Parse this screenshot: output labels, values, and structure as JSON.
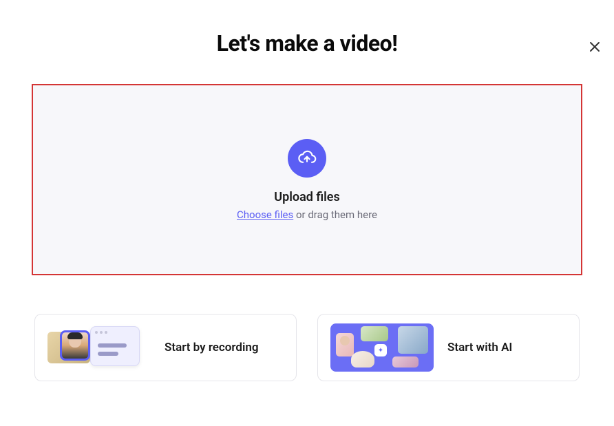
{
  "title": "Let's make a video!",
  "close_icon": "close",
  "upload": {
    "heading": "Upload files",
    "choose_link": "Choose files",
    "drag_suffix": " or drag them here",
    "icon": "cloud-upload"
  },
  "options": {
    "record": {
      "label": "Start by recording"
    },
    "ai": {
      "label": "Start with AI"
    }
  },
  "colors": {
    "accent": "#5b5ef4",
    "highlight_border": "#d43535"
  }
}
